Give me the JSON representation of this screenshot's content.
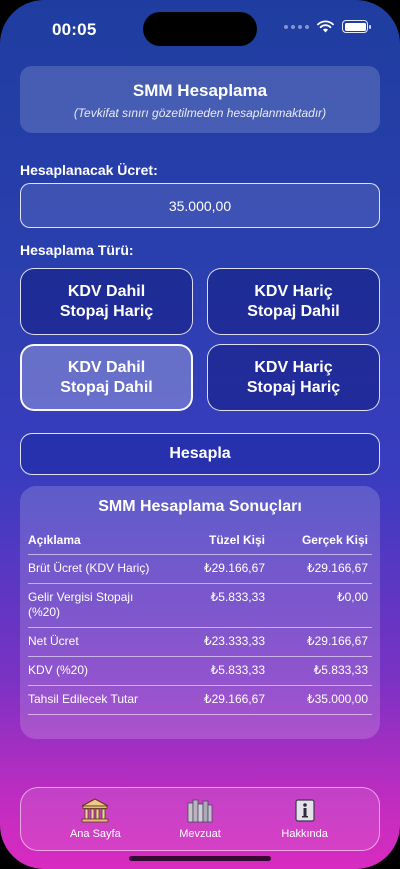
{
  "status_bar": {
    "time": "00:05"
  },
  "header": {
    "title": "SMM Hesaplama",
    "subtitle": "(Tevkifat sınırı gözetilmeden hesaplanmaktadır)"
  },
  "amount": {
    "label": "Hesaplanacak Ücret:",
    "value": "35.000,00"
  },
  "calc_type": {
    "label": "Hesaplama Türü:",
    "options": [
      {
        "label": "KDV Dahil\nStopaj Hariç",
        "selected": false
      },
      {
        "label": "KDV Hariç\nStopaj Dahil",
        "selected": false
      },
      {
        "label": "KDV Dahil\nStopaj Dahil",
        "selected": true
      },
      {
        "label": "KDV Hariç\nStopaj Hariç",
        "selected": false
      }
    ]
  },
  "calculate_button": "Hesapla",
  "results": {
    "title": "SMM Hesaplama Sonuçları",
    "headers": [
      "Açıklama",
      "Tüzel Kişi",
      "Gerçek Kişi"
    ],
    "rows": [
      [
        "Brüt Ücret (KDV Hariç)",
        "₺29.166,67",
        "₺29.166,67"
      ],
      [
        "Gelir Vergisi Stopajı (%20)",
        "₺5.833,33",
        "₺0,00"
      ],
      [
        "Net Ücret",
        "₺23.333,33",
        "₺29.166,67"
      ],
      [
        "KDV (%20)",
        "₺5.833,33",
        "₺5.833,33"
      ],
      [
        "Tahsil Edilecek Tutar",
        "₺29.166,67",
        "₺35.000,00"
      ]
    ]
  },
  "tabs": [
    {
      "label": "Ana Sayfa",
      "icon": "bank-icon"
    },
    {
      "label": "Mevzuat",
      "icon": "books-icon"
    },
    {
      "label": "Hakkında",
      "icon": "info-icon"
    }
  ]
}
